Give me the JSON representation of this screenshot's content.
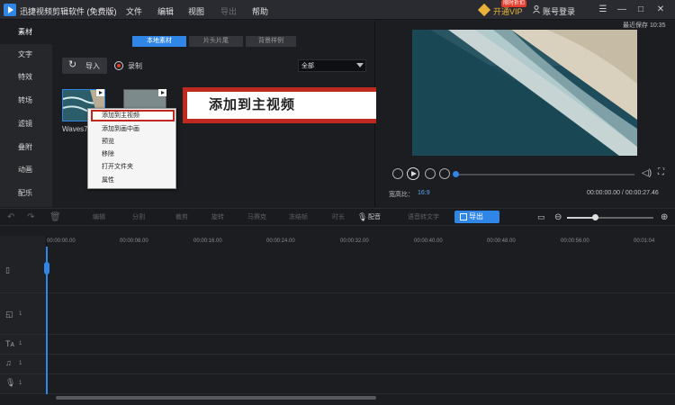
{
  "app": {
    "title": "迅捷视频剪辑软件 (免费版)"
  },
  "menu": [
    "文件",
    "编辑",
    "视图",
    "导出",
    "帮助"
  ],
  "header": {
    "vip_label": "开通VIP",
    "vip_badge": "限时折扣",
    "login_label": "账号登录"
  },
  "sidebar": {
    "items": [
      "素材",
      "文字",
      "特效",
      "转场",
      "滤镜",
      "叠附",
      "动画",
      "配乐"
    ]
  },
  "media": {
    "tabs": [
      "本地素材",
      "片头片尾",
      "背景样例"
    ],
    "import_label": "导入",
    "record_label": "录制",
    "filter_value": "全部",
    "thumb1_name": "Waves7"
  },
  "context_menu": [
    "添加到主视频",
    "添加到画中画",
    "预览",
    "移除",
    "打开文件夹",
    "属性"
  ],
  "callout": "添加到主视频",
  "preview": {
    "last_save": "最近保存 10:35",
    "aspect_label": "宽高比：",
    "aspect_value": "16:9",
    "time": "00:00:00.00 / 00:00:27.46"
  },
  "toolbar": {
    "tools": [
      "编辑",
      "分割",
      "裁剪",
      "旋转",
      "马赛克",
      "冻结帧",
      "时长",
      "配音",
      "语音转文字"
    ],
    "export_label": "导出"
  },
  "timeline": {
    "ticks": [
      "00:00:00.00",
      "00:00:08.00",
      "00:00:16.00",
      "00:00:24.00",
      "00:00:32.00",
      "00:00:40.00",
      "00:00:48.00",
      "00:00:56.00",
      "00:01:04"
    ],
    "track_nums": [
      "1",
      "1",
      "1",
      "1"
    ]
  },
  "colors": {
    "accent": "#2f86e6",
    "callout_border": "#c0291f",
    "vip": "#e9b23a"
  }
}
